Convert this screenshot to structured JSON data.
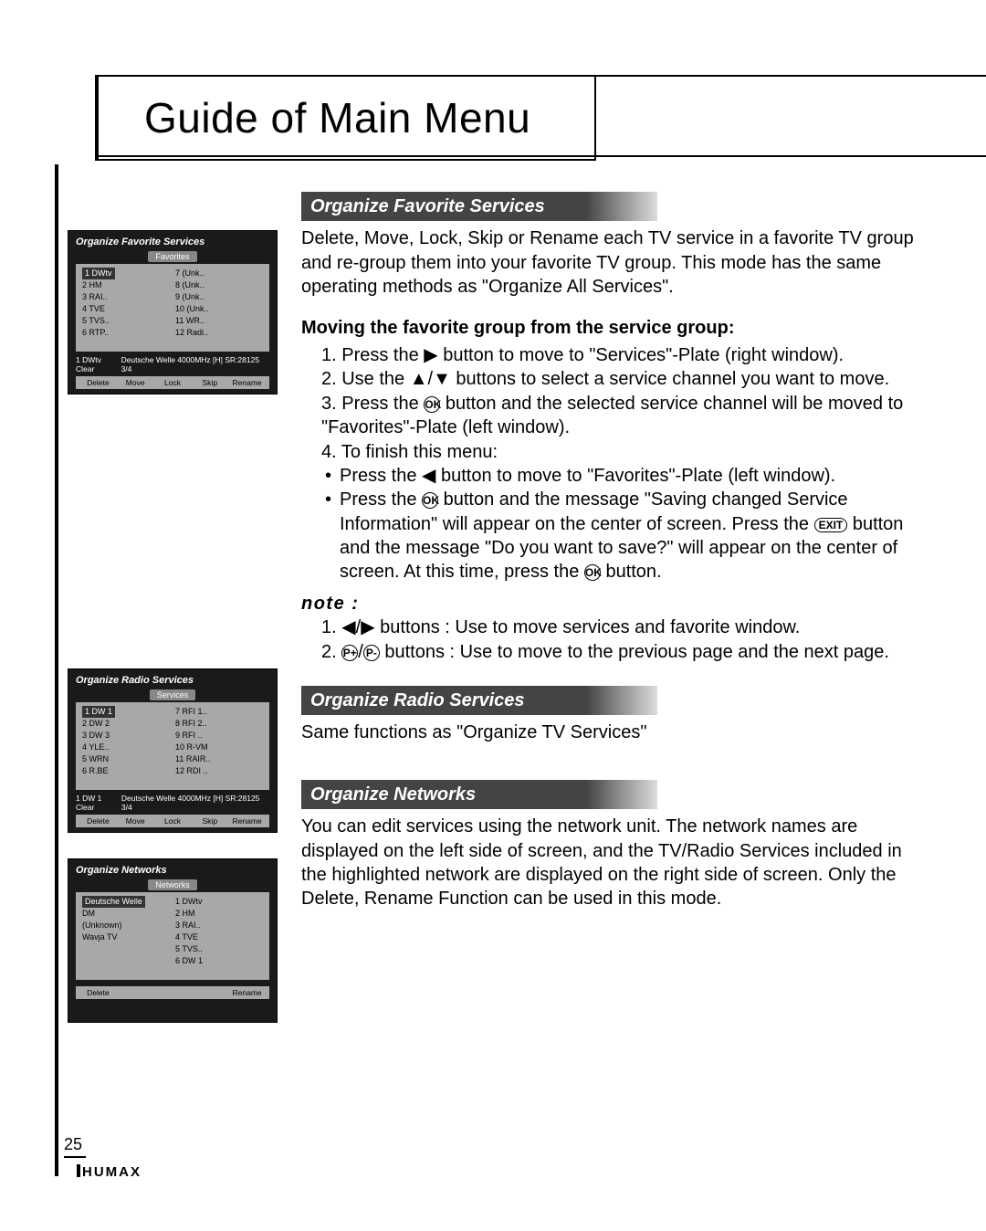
{
  "title": "Guide of Main Menu",
  "page_number": "25",
  "brand": "HUMAX",
  "symbols": {
    "right": "▶",
    "left": "◀",
    "updown": "▲/▼",
    "leftright": "◀/▶",
    "ok": "OK",
    "ok2": "OK",
    "exit": "EXIT",
    "pplus": "P+",
    "pminus": "P-"
  },
  "sections": {
    "fav": {
      "heading": "Organize Favorite Services",
      "intro": "Delete, Move, Lock, Skip or Rename each TV service in a favorite TV group and re-group them into your favorite TV group. This mode has the same operating methods as \"Organize All Services\".",
      "sub": "Moving the favorite group from the service group:",
      "s1a": "1. Press the ",
      "s1b": " button to move to \"Services\"-Plate (right window).",
      "s2a": "2. Use the ",
      "s2b": " buttons to select a service channel you want to move.",
      "s3a": "3. Press the ",
      "s3b": " button and the selected service channel will be moved to \"Favorites\"-Plate (left window).",
      "s4": "4. To finish this menu:",
      "b1a": "Press the ",
      "b1b": " button to move to \"Favorites\"-Plate (left window).",
      "b2a": "Press the ",
      "b2b": " button and the message \"Saving changed Service Information\" will appear on the center of screen. Press the ",
      "b2c": " button and the message \"Do you want to save?\" will appear on the center of screen. At this time, press the ",
      "b2d": " button."
    },
    "note": {
      "label": "note :",
      "n1a": "1. ",
      "n1b": " buttons : Use to move services and favorite window.",
      "n2a": "2. ",
      "n2b": "/",
      "n2c": " buttons : Use to move to the previous page and the next page."
    },
    "radio": {
      "heading": "Organize Radio Services",
      "text": "Same functions as \"Organize TV Services\""
    },
    "net": {
      "heading": "Organize Networks",
      "text": "You can edit services using the network unit. The network names are displayed on the left side of screen, and the TV/Radio Services included in the highlighted network are displayed on the right side of screen. Only the Delete, Rename Function can be used in this mode."
    }
  },
  "shots": {
    "fav": {
      "title": "Organize Favorite Services",
      "pane_label": "Favorites",
      "left": [
        "1 DWtv",
        "2 HM",
        "3 RAI..",
        "4 TVE",
        "5 TVS..",
        "6 RTP.."
      ],
      "right": [
        "7 (Unk..",
        "8 (Unk..",
        "9 (Unk..",
        "10 (Unk..",
        "11 WR..",
        "12 Radi.."
      ],
      "status_l": "1 DWtv Clear",
      "status_r": "Deutsche Welle 4000MHz [H] SR:28125 3/4",
      "actions": [
        "Delete",
        "Move",
        "Lock",
        "Skip",
        "Rename"
      ]
    },
    "radio": {
      "title": "Organize Radio Services",
      "pane_label": "Services",
      "left": [
        "1 DW 1",
        "2 DW 2",
        "3 DW 3",
        "4 YLE..",
        "5 WRN",
        "6 R.BE"
      ],
      "right": [
        "7 RFI 1..",
        "8 RFI 2..",
        "9 RFI ..",
        "10 R-VM",
        "11 RAIR..",
        "12 RDI .."
      ],
      "status_l": "1 DW 1 Clear",
      "status_r": "Deutsche Welle 4000MHz [H] SR:28125 3/4",
      "actions": [
        "Delete",
        "Move",
        "Lock",
        "Skip",
        "Rename"
      ]
    },
    "net": {
      "title": "Organize Networks",
      "pane_label": "Networks",
      "left": [
        "Deutsche Welle",
        "DM",
        "(Unknown)",
        "Wavja TV"
      ],
      "right": [
        "1 DWtv",
        "2 HM",
        "3 RAI..",
        "4 TVE",
        "5 TVS..",
        "6 DW 1"
      ],
      "status_l": "",
      "status_r": "",
      "actions": [
        "Delete",
        "",
        "",
        "",
        "Rename"
      ]
    }
  }
}
